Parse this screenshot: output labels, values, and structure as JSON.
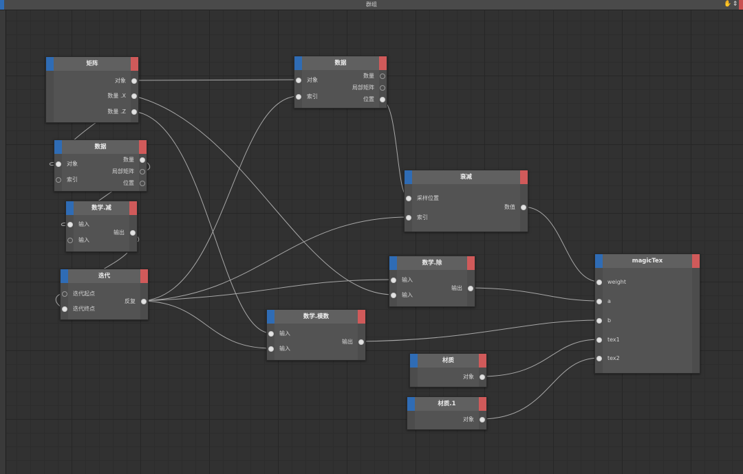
{
  "window": {
    "title": "群组",
    "icons": [
      "hand-icon",
      "pin-icon"
    ],
    "accent_left": "#2f6cb5",
    "accent_right": "#c85050"
  },
  "colors": {
    "background": "#313131",
    "node_body": "#535353",
    "node_header": "#606060",
    "header_left": "#2f6cb5",
    "header_right": "#d05a5a",
    "wire": "#a8a8a8"
  },
  "nodes": {
    "matrix": {
      "title": "矩阵",
      "outputs": [
        "对象",
        "数量 .X",
        "数量 .Z"
      ]
    },
    "data1": {
      "title": "数据",
      "inputs": [
        "对象",
        "索引"
      ],
      "outputs": [
        "数量",
        "局部矩阵",
        "位置"
      ]
    },
    "data2": {
      "title": "数据",
      "inputs": [
        "对象",
        "索引"
      ],
      "outputs": [
        "数量",
        "局部矩阵",
        "位置"
      ]
    },
    "subtract": {
      "title": "数学.减",
      "inputs": [
        "输入",
        "输入"
      ],
      "outputs": [
        "输出"
      ]
    },
    "iterate": {
      "title": "迭代",
      "inputs": [
        "迭代起点",
        "迭代终点"
      ],
      "outputs": [
        "反复"
      ]
    },
    "decay": {
      "title": "衰减",
      "inputs": [
        "采样位置",
        "索引"
      ],
      "outputs": [
        "数值"
      ]
    },
    "divide": {
      "title": "数学.除",
      "inputs": [
        "输入",
        "输入"
      ],
      "outputs": [
        "输出"
      ]
    },
    "modulo": {
      "title": "数学.模数",
      "inputs": [
        "输入",
        "输入"
      ],
      "outputs": [
        "输出"
      ]
    },
    "magictex": {
      "title": "magicTex",
      "inputs": [
        "weight",
        "a",
        "b",
        "tex1",
        "tex2"
      ]
    },
    "material1": {
      "title": "材质",
      "outputs": [
        "对象"
      ]
    },
    "material2": {
      "title": "材质.1",
      "outputs": [
        "对象"
      ]
    }
  }
}
